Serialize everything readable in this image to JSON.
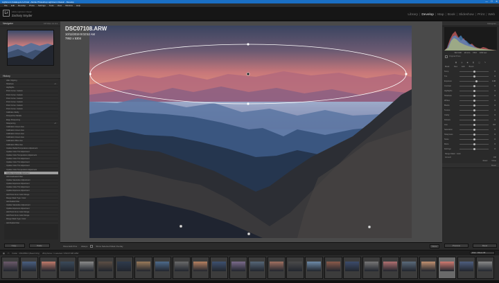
{
  "window": {
    "title": "Lightroom Catalog-2-2-2.lrcat - Adobe Photoshop Lightroom Classic - Develop",
    "controls": [
      "—",
      "☐",
      "✕"
    ]
  },
  "menu": [
    "File",
    "Edit",
    "Develop",
    "Photo",
    "Settings",
    "Tools",
    "View",
    "Window",
    "Help"
  ],
  "identity": {
    "logo": "Lr",
    "subtitle": "Adobe Lightroom Classic",
    "user": "Zachary Snyder"
  },
  "modules": [
    "Library",
    "Develop",
    "Map",
    "Book",
    "Slideshow",
    "Print",
    "Web"
  ],
  "active_module": "Develop",
  "left_panel": {
    "navigator": {
      "title": "Navigator",
      "zoom": "FIT  FILL  1:1  3:1"
    },
    "history": [
      {
        "label": "After Clipping",
        "value": ""
      },
      {
        "label": "Shadows",
        "value": "+9"
      },
      {
        "label": "Highlights",
        "value": ""
      },
      {
        "label": "Point Curve: Custom",
        "value": ""
      },
      {
        "label": "Point Curve: Custom",
        "value": ""
      },
      {
        "label": "Point Curve: Custom",
        "value": ""
      },
      {
        "label": "Point Curve: Custom",
        "value": ""
      },
      {
        "label": "Point Curve: Custom",
        "value": ""
      },
      {
        "label": "Point Curve: Custom",
        "value": ""
      },
      {
        "label": "Calibrate Clarity",
        "value": ""
      },
      {
        "label": "Perspective Metals",
        "value": ""
      },
      {
        "label": "Edge Sharpening",
        "value": ""
      },
      {
        "label": "Sharpening",
        "value": "+8"
      },
      {
        "label": "Calibration Green Hue",
        "value": ""
      },
      {
        "label": "Calibration Green Hue",
        "value": ""
      },
      {
        "label": "Calibration Green Hue",
        "value": ""
      },
      {
        "label": "Calibration Green Hue",
        "value": ""
      },
      {
        "label": "Calibration Blue Hue",
        "value": ""
      },
      {
        "label": "Calibration Blue Hue",
        "value": ""
      },
      {
        "label": "Update Radial Temperature Adjustment",
        "value": ""
      },
      {
        "label": "Update Color Tint Adjustment",
        "value": ""
      },
      {
        "label": "Update Color Temperature Adjustment",
        "value": ""
      },
      {
        "label": "Update Color Tint Adjustment",
        "value": ""
      },
      {
        "label": "Update Color Tint Adjustment",
        "value": ""
      },
      {
        "label": "Update Color Tint Adjustment",
        "value": ""
      },
      {
        "label": "Update Color Temperature Adjustment",
        "value": ""
      },
      {
        "label": "Update Exposure Adjustment",
        "value": ""
      },
      {
        "label": "Add Graduated Filter",
        "value": ""
      },
      {
        "label": "Update Saturation Adjustment",
        "value": ""
      },
      {
        "label": "Update Exposure Adjustment",
        "value": ""
      },
      {
        "label": "Update Color Tint Adjustment",
        "value": ""
      },
      {
        "label": "Update Exposure Adjustment",
        "value": ""
      },
      {
        "label": "Add Point From Color Range",
        "value": ""
      },
      {
        "label": "Range Mask Type: Color",
        "value": ""
      },
      {
        "label": "Add Radial Filter",
        "value": ""
      },
      {
        "label": "Update Saturation Adjustment",
        "value": ""
      },
      {
        "label": "Update Exposure Adjustment",
        "value": ""
      },
      {
        "label": "Add Point From Color Range",
        "value": ""
      },
      {
        "label": "Add Point From Color Range",
        "value": ""
      },
      {
        "label": "Range Mask Type: Color",
        "value": ""
      },
      {
        "label": "Add Radial Filter",
        "value": ""
      }
    ],
    "selected_history_index": 26,
    "buttons": {
      "copy": "Copy...",
      "paste": "Paste"
    }
  },
  "photo": {
    "filename": "DSC07108.ARW",
    "datetime": "10/11/2019 9:02:52 AM",
    "dimensions": "7952 x 5304"
  },
  "toolbar": {
    "show_edit_pins": "Show Edit Pins :",
    "pins_mode": "Always",
    "show_mask": "Show Selected Mask Overlay",
    "done": "Done"
  },
  "right_panel": {
    "histogram_title": "Histogram",
    "histogram_values": [
      "ISO 100",
      "24 mm",
      "f/8.0",
      "1/60 sec"
    ],
    "original_photo": "Original Photo",
    "mask_labels": [
      "Mask:",
      "New",
      "Edit",
      "Brush"
    ],
    "sliders": [
      {
        "label": "Temp",
        "value": "0",
        "pos": 0.5
      },
      {
        "label": "Tint",
        "value": "0",
        "pos": 0.5
      },
      {
        "label": "Exposure",
        "value": "1.06",
        "pos": 0.58
      },
      {
        "label": "Contrast",
        "value": "0",
        "pos": 0.5
      },
      {
        "label": "Highlights",
        "value": "0",
        "pos": 0.5
      },
      {
        "label": "Shadows",
        "value": "0",
        "pos": 0.5
      },
      {
        "label": "Whites",
        "value": "0",
        "pos": 0.5
      },
      {
        "label": "Blacks",
        "value": "0",
        "pos": 0.5
      },
      {
        "label": "Texture",
        "value": "0",
        "pos": 0.5
      },
      {
        "label": "Clarity",
        "value": "0",
        "pos": 0.5
      },
      {
        "label": "Dehaze",
        "value": "0",
        "pos": 0.5
      },
      {
        "label": "Hue",
        "value": "0.0",
        "pos": 0.5
      },
      {
        "label": "Saturation",
        "value": "0",
        "pos": 0.5
      },
      {
        "label": "Sharpness",
        "value": "0",
        "pos": 0.5
      },
      {
        "label": "Noise",
        "value": "0",
        "pos": 0.5
      },
      {
        "label": "Moire",
        "value": "0",
        "pos": 0.5
      },
      {
        "label": "Defringe",
        "value": "0",
        "pos": 0.5
      }
    ],
    "range_mask": "Range Mask : Color",
    "amount": "Amount",
    "amount_value": "100",
    "reset": "Reset",
    "close": "Close",
    "basic_label": "Basic",
    "buttons": {
      "previous": "Previous",
      "reset": "Reset"
    }
  },
  "filmbar": {
    "label": "Folder : DSC08910 (Read Only)",
    "count": "264 photos / 1 selected / DSC07108.ARW",
    "filter": "Filter : Filters Off"
  },
  "filmstrip": {
    "count": 26,
    "selected_index": 23
  },
  "colors": {
    "accent": "#1a6fc4",
    "panel": "#2a2a2a",
    "canvas": "#4a4a4a",
    "selected_history": "#9e9e9e"
  }
}
